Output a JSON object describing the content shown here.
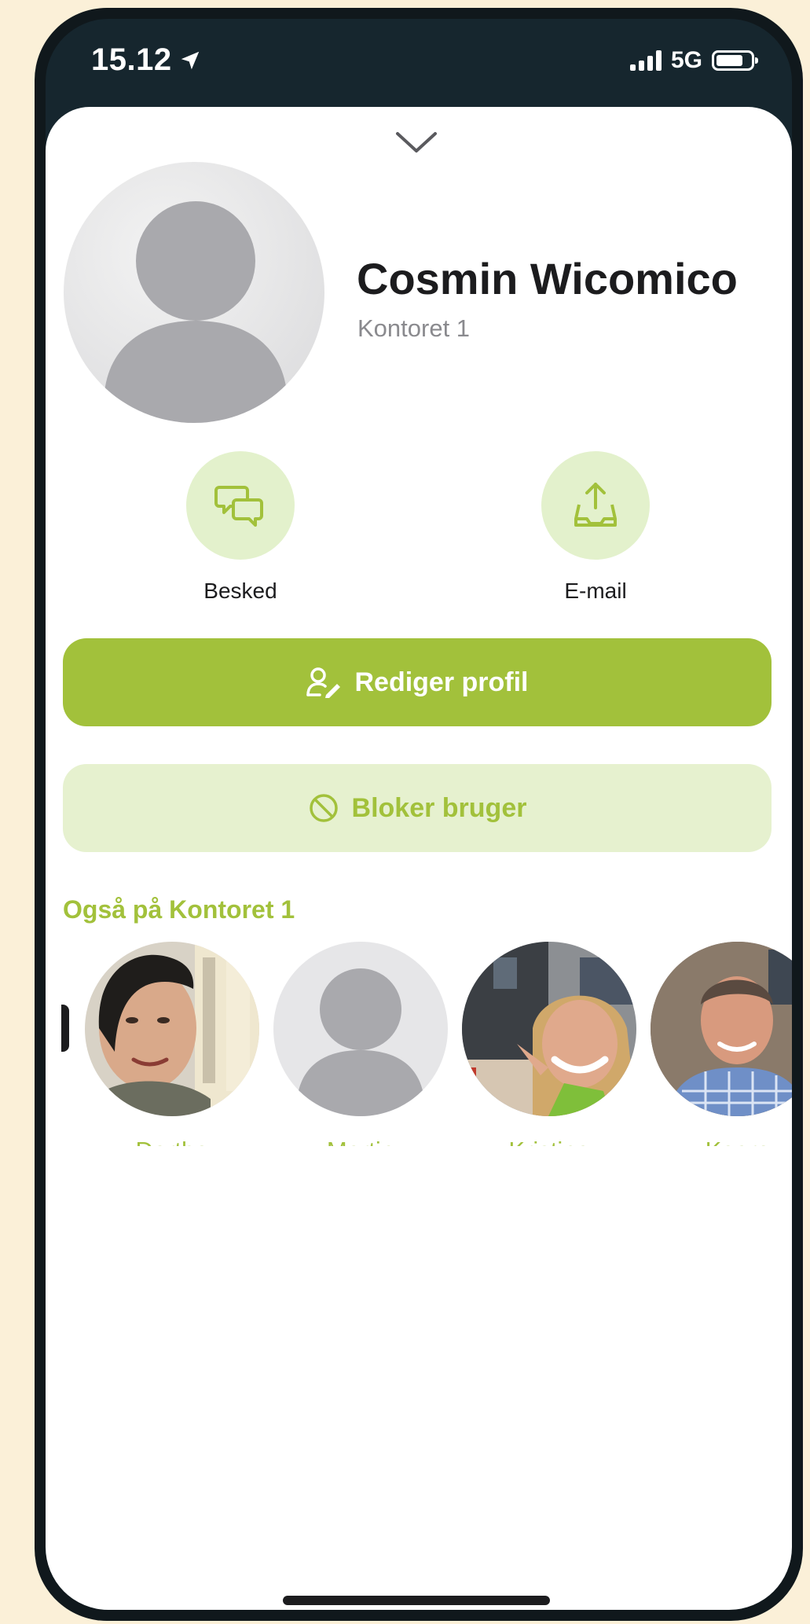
{
  "status_bar": {
    "time": "15.12",
    "network": "5G"
  },
  "profile": {
    "name": "Cosmin Wicomico",
    "subtitle": "Kontoret 1"
  },
  "actions": [
    {
      "label": "Besked",
      "icon": "chat-bubbles-icon"
    },
    {
      "label": "E-mail",
      "icon": "share-tray-icon"
    }
  ],
  "buttons": {
    "edit_label": "Rediger profil",
    "edit_icon": "user-edit-icon",
    "block_label": "Bloker bruger",
    "block_icon": "block-icon"
  },
  "section": {
    "title": "Også på Kontoret 1"
  },
  "people": [
    {
      "name": "Dorthe"
    },
    {
      "name": "Martin"
    },
    {
      "name": "Kristina"
    },
    {
      "name": "Kaare"
    }
  ],
  "colors": {
    "accent": "#a2c13b",
    "accent_light": "#e6f1cf",
    "background": "#fbf0d8",
    "status_bar_bg": "#16262e"
  }
}
